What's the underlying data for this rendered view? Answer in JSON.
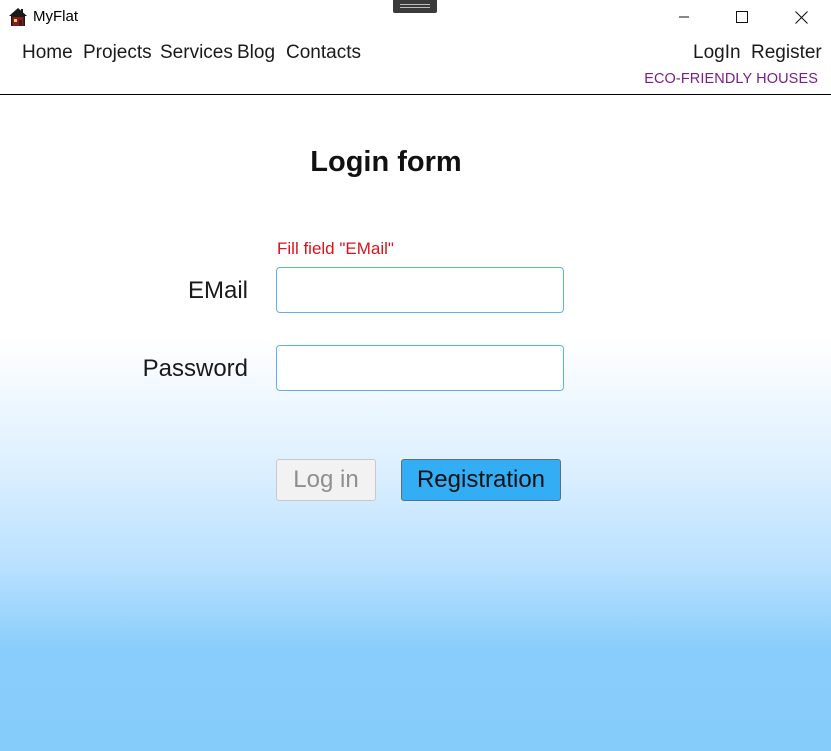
{
  "window": {
    "title": "MyFlat",
    "icons": {
      "app": "house-icon",
      "minimize": "minimize-icon",
      "maximize": "maximize-icon",
      "close": "close-icon"
    }
  },
  "nav": {
    "left": [
      "Home",
      "Projects",
      "Services",
      "Blog",
      "Contacts"
    ],
    "right": [
      "LogIn",
      "Register"
    ],
    "tagline": "ECO-FRIENDLY HOUSES"
  },
  "form": {
    "title": "Login form",
    "error": "Fill field \"EMail\"",
    "email_label": "EMail",
    "email_value": "",
    "password_label": "Password",
    "password_value": "",
    "login_button": "Log in",
    "register_button": "Registration"
  },
  "colors": {
    "tagline": "#7b1f86",
    "error": "#d8141c",
    "input_border": "#5cb3e6",
    "register_button": "#33adf4",
    "background_bottom": "#86ccfb"
  }
}
